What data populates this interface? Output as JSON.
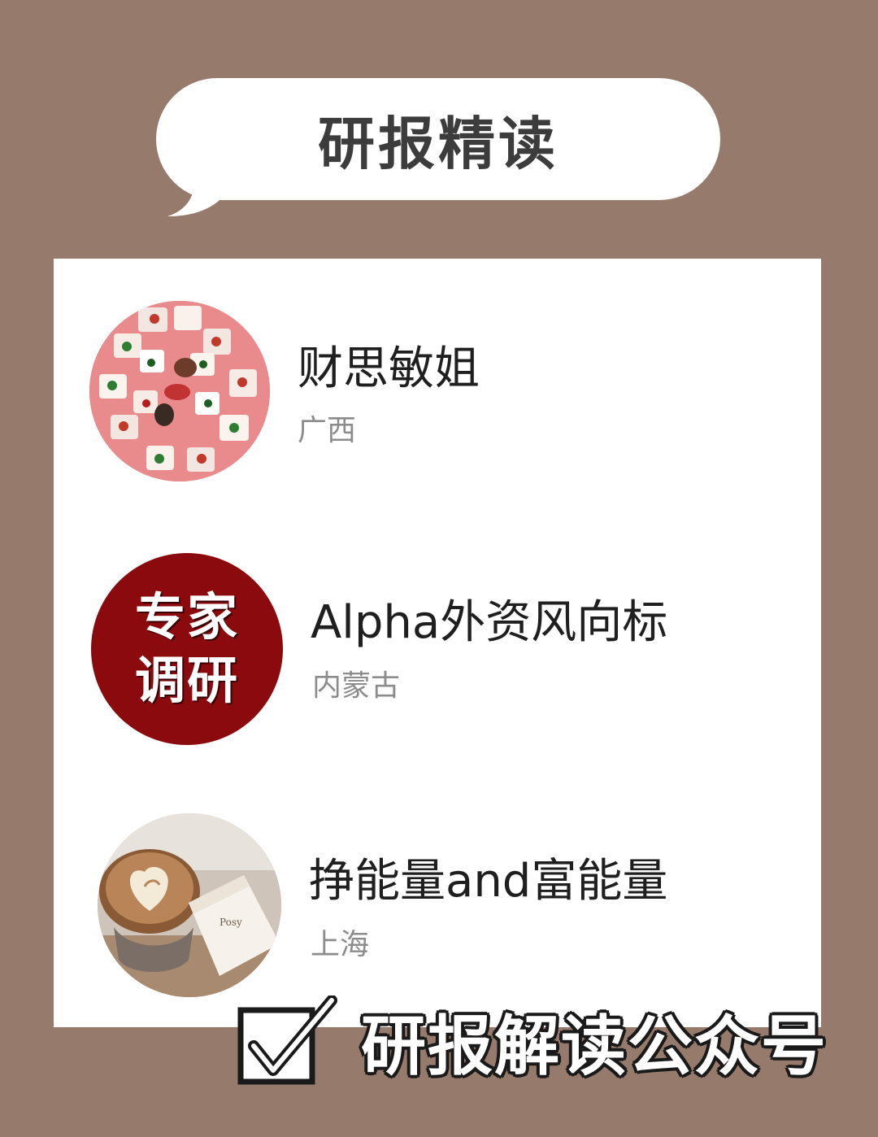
{
  "header": {
    "title": "研报精读"
  },
  "accounts": [
    {
      "name": "财思敏姐",
      "location": "广西",
      "avatar": "pink-sticker-collage"
    },
    {
      "name": "Alpha外资风向标",
      "location": "内蒙古",
      "avatar": "red-circle-text-logo",
      "avatar_text_line1": "专家",
      "avatar_text_line2": "调研"
    },
    {
      "name": "挣能量and富能量",
      "location": "上海",
      "avatar": "latte-coffee-photo"
    }
  ],
  "footer": {
    "caption": "研报解读公众号",
    "icon": "checkbox-checked-icon"
  },
  "colors": {
    "background": "#967a6b",
    "card": "#ffffff",
    "avatar_red": "#8b0a0e",
    "avatar_pink": "#e98a8c"
  }
}
